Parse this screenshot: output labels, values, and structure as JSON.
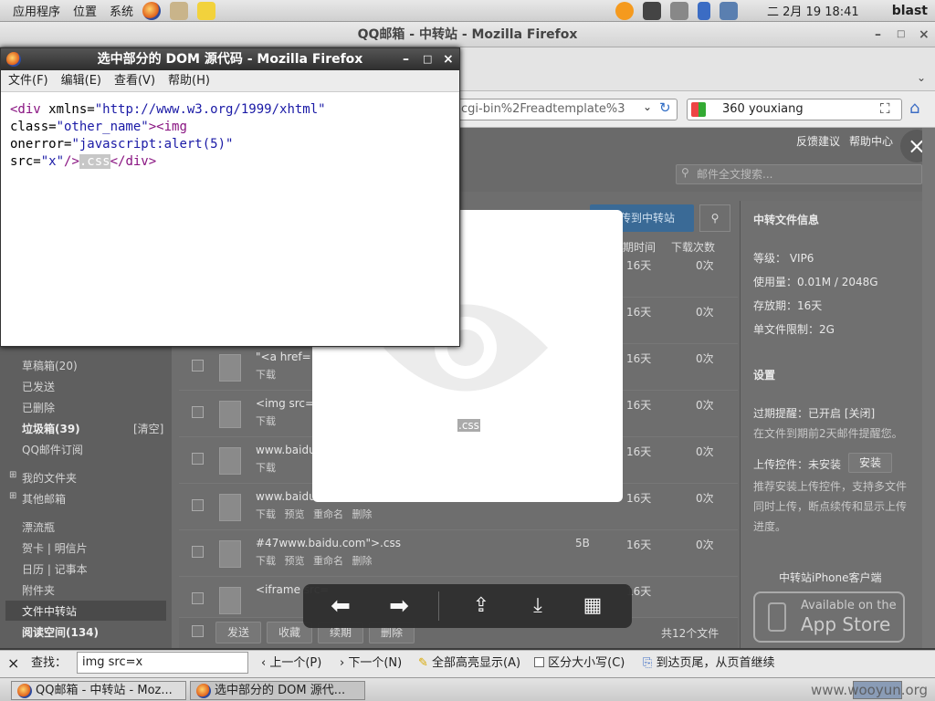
{
  "top_panel": {
    "menus": [
      "应用程序",
      "位置",
      "系统"
    ],
    "clock": "二 2月 19 18:41",
    "user": "blast"
  },
  "firefox_main": {
    "title": "QQ邮箱 - 中转站 - Mozilla Firefox",
    "url": "cgi-bin%2Freadtemplate%3",
    "search_value": "360 youxiang"
  },
  "mail": {
    "top_links": [
      "反馈建议",
      "帮助中心"
    ],
    "search_placeholder": "邮件全文搜索...",
    "upload_button": "上传到中转站",
    "columns": {
      "expire": "期时间",
      "downloads": "下载次数"
    },
    "sidebar": [
      {
        "label": "草稿箱(20)",
        "bold": false
      },
      {
        "label": "已发送",
        "bold": false
      },
      {
        "label": "已删除",
        "bold": false
      },
      {
        "label": "垃圾箱(39)",
        "bold": true,
        "extra": "[清空]"
      },
      {
        "label": "QQ邮件订阅",
        "bold": false
      },
      {
        "label": "我的文件夹",
        "bold": false
      },
      {
        "label": "其他邮箱",
        "bold": false
      },
      {
        "label": "漂流瓶",
        "bold": false
      },
      {
        "label": "贺卡 | 明信片",
        "bold": false
      },
      {
        "label": "日历 | 记事本",
        "bold": false
      },
      {
        "label": "附件夹",
        "bold": false
      },
      {
        "label": "文件中转站",
        "bold": false
      },
      {
        "label": "阅读空间(134)",
        "bold": true
      }
    ],
    "files": [
      {
        "name": "",
        "size": "",
        "ttl": "16天",
        "count": "0次",
        "actions": ""
      },
      {
        "name": "",
        "size": "",
        "ttl": "16天",
        "count": "0次",
        "actions": ""
      },
      {
        "name": "\"<a href=",
        "size": "",
        "ttl": "16天",
        "count": "0次",
        "actions": "下载"
      },
      {
        "name": "<img src=",
        "size": "",
        "ttl": "16天",
        "count": "0次",
        "actions": "下载"
      },
      {
        "name": "www.baidu",
        "size": "",
        "ttl": "16天",
        "count": "0次",
        "actions": "下载"
      },
      {
        "name": "www.baidu.com\">.css",
        "size": "5B",
        "ttl": "16天",
        "count": "0次",
        "actions": "下载  预览  重命名  删除"
      },
      {
        "name": "#47www.baidu.com\">.css",
        "size": "5B",
        "ttl": "16天",
        "count": "0次",
        "actions": "下载  预览  重命名  删除"
      },
      {
        "name": "<iframe src=",
        "size": "",
        "ttl": "16天",
        "count": "",
        "actions": ""
      }
    ],
    "bottom_buttons": [
      "发送",
      "收藏",
      "续期",
      "删除"
    ],
    "total_files": "共12个文件",
    "info": {
      "title": "中转文件信息",
      "level": "等级：  VIP6",
      "usage": "使用量：0.01M / 2048G",
      "storage": "存放期：16天",
      "limit": "单文件限制：2G",
      "settings_title": "设置",
      "reminder": "过期提醒：已开启 [关闭]",
      "reminder_note": "在文件到期前2天邮件提醒您。",
      "upload_ctrl": "上传控件：未安装",
      "install_btn": "安装",
      "upload_note": "推荐安装上传控件，支持多文件同时上传，断点续传和显示上传进度。",
      "iphone": "中转站iPhone客户端",
      "appstore_small": "Available on the",
      "appstore_big": "App Store"
    }
  },
  "preview": {
    "label": ".css"
  },
  "dom_window": {
    "title": "选中部分的 DOM 源代码 - Mozilla Firefox",
    "menu": [
      "文件(F)",
      "编辑(E)",
      "查看(V)",
      "帮助(H)"
    ],
    "code": {
      "l1_tag": "<div",
      "l1_attr": " xmlns=",
      "l1_val": "\"http://www.w3.org/1999/xhtml\"",
      "l2_attr": "class=",
      "l2_val": "\"other_name\"",
      "l2_tag": "><img",
      "l3_attr": "onerror=",
      "l3_val": "\"javascript:alert(5)\"",
      "l4_attr": "src=",
      "l4_val": "\"x\"",
      "l4_tag": "/>",
      "l4_hl": ".css",
      "l4_end": "</div>"
    }
  },
  "findbar": {
    "label": "查找：",
    "value": "img src=x",
    "prev": "上一个(P)",
    "next": "下一个(N)",
    "highlight": "全部高亮显示(A)",
    "matchcase": "区分大小写(C)",
    "status": "到达页尾，从页首继续"
  },
  "taskbar": {
    "tasks": [
      "QQ邮箱 - 中转站 - Moz...",
      "选中部分的 DOM 源代..."
    ],
    "watermark": "www.wooyun.org"
  }
}
